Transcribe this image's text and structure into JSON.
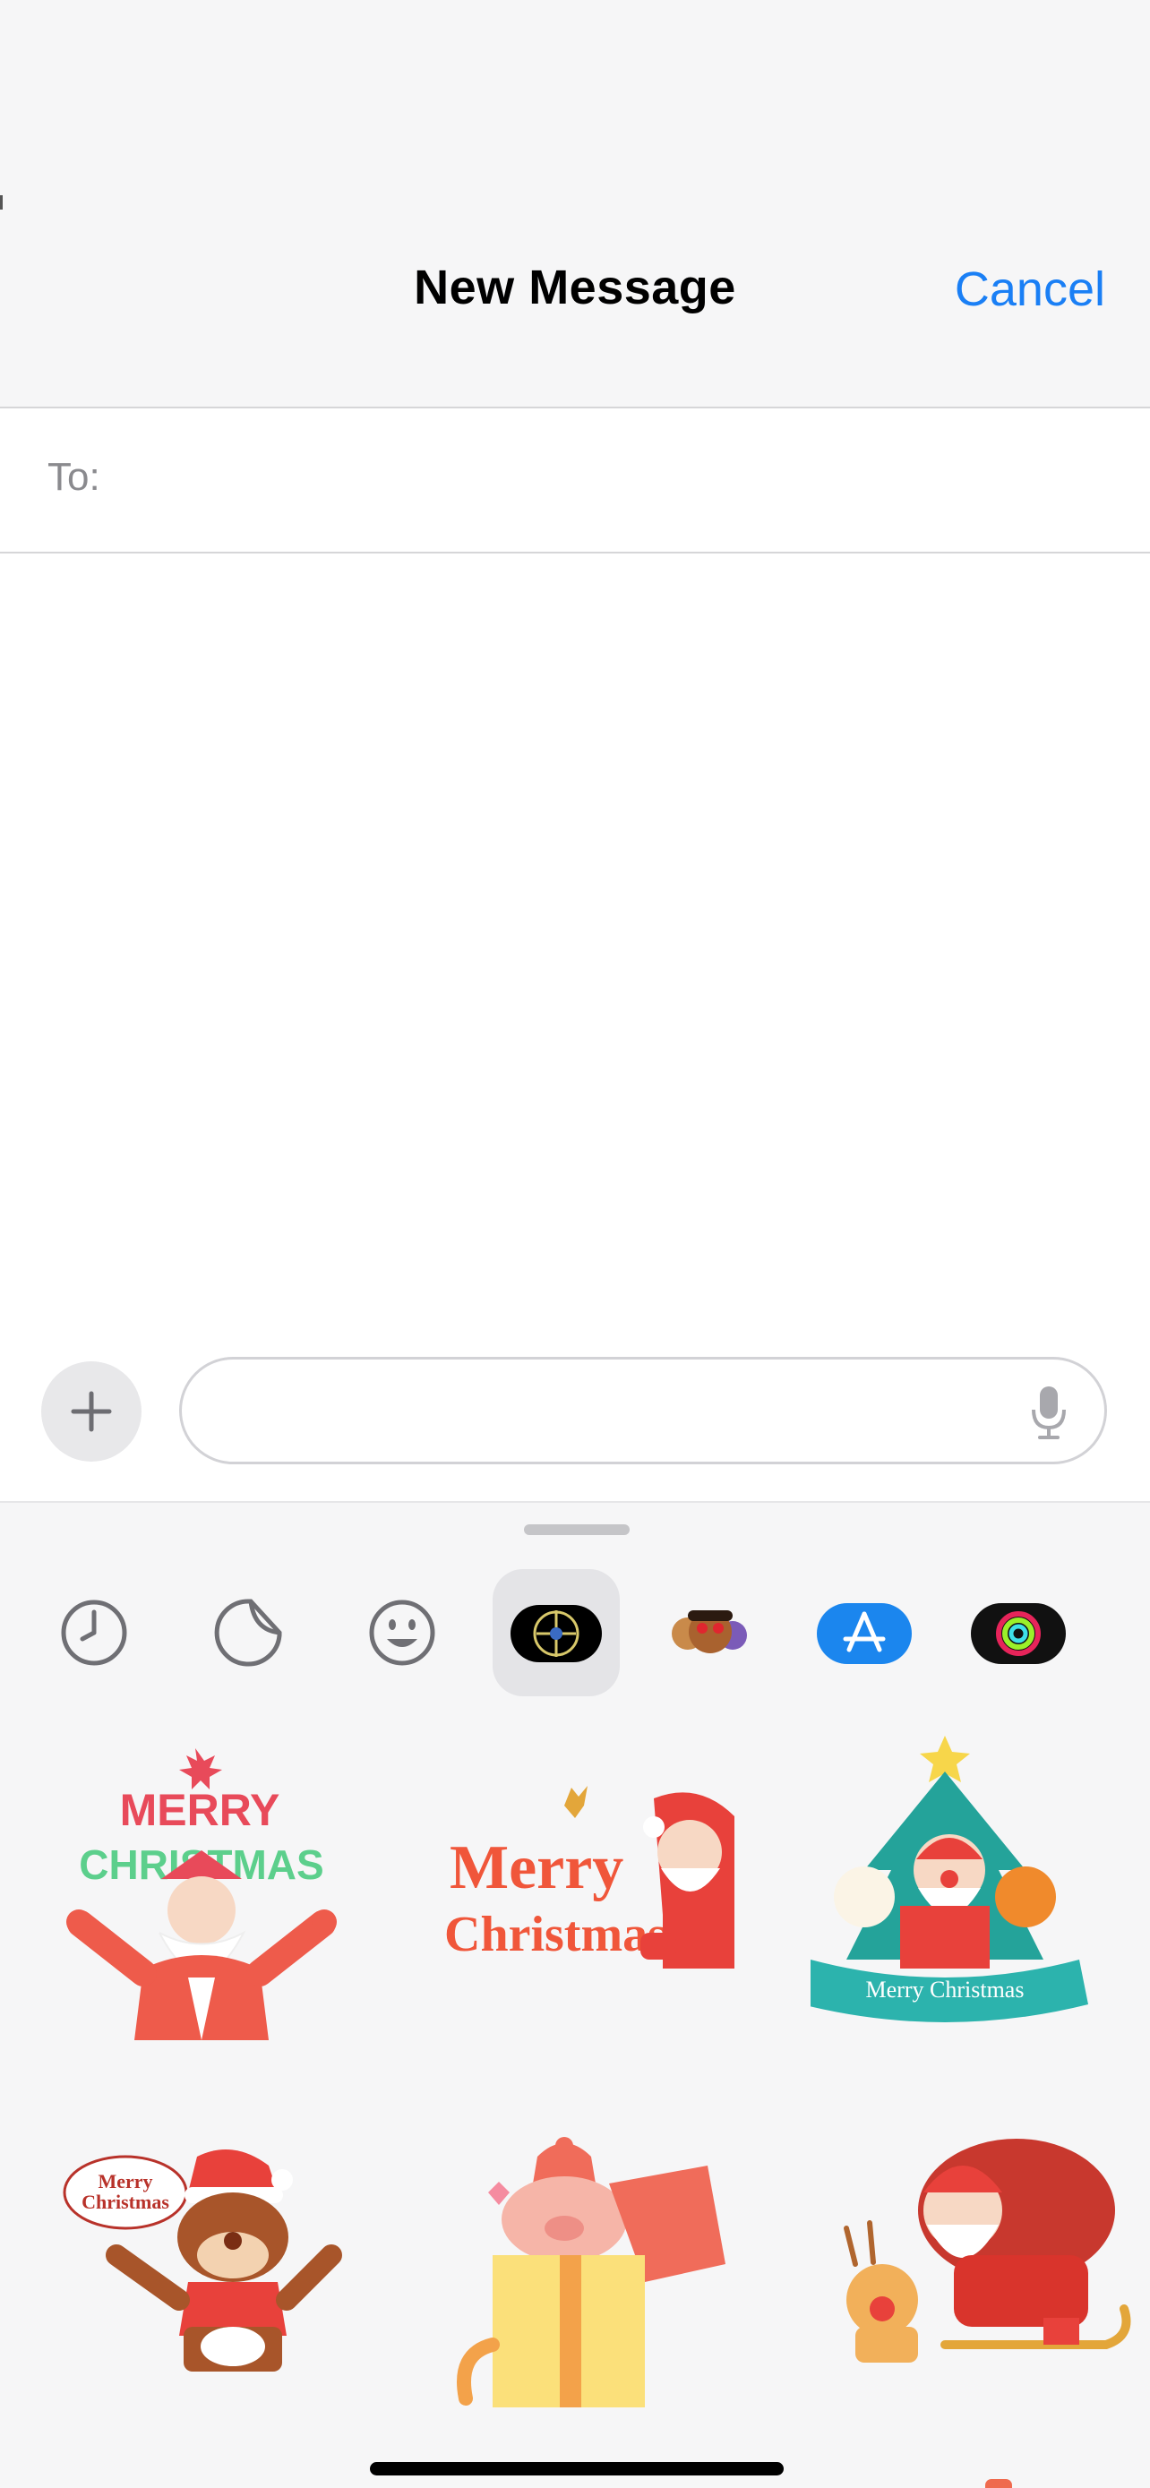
{
  "header": {
    "title": "New Message",
    "cancel_label": "Cancel"
  },
  "to_field": {
    "label": "To:",
    "value": ""
  },
  "compose": {
    "message_value": "",
    "plus_icon": "plus-icon",
    "mic_icon": "microphone-icon"
  },
  "app_drawer": {
    "apps": [
      {
        "name": "recents",
        "icon": "clock-icon"
      },
      {
        "name": "stickers",
        "icon": "sticker-icon"
      },
      {
        "name": "emoji",
        "icon": "smiley-icon"
      },
      {
        "name": "sticker-pack",
        "icon": "sticker-pack-icon",
        "selected": true
      },
      {
        "name": "memoji",
        "icon": "memoji-icon"
      },
      {
        "name": "app-store",
        "icon": "app-store-icon"
      },
      {
        "name": "fitness",
        "icon": "activity-rings-icon"
      }
    ],
    "stickers": [
      {
        "name": "sticker-santa-merry-christmas",
        "text": [
          "MERRY",
          "CHRISTMAS"
        ]
      },
      {
        "name": "sticker-merry-christmas-santa-peek",
        "text": [
          "Merry",
          "Christmas"
        ]
      },
      {
        "name": "sticker-christmas-tree-banner",
        "text": [
          "Merry Christmas"
        ]
      },
      {
        "name": "sticker-reindeer-merry-christmas",
        "text": [
          "Merry",
          "Christmas"
        ]
      },
      {
        "name": "sticker-pig-gift-box",
        "text": []
      },
      {
        "name": "sticker-santa-sleigh-reindeer",
        "text": []
      }
    ]
  },
  "colors": {
    "accent": "#1a7ff5",
    "header_bg": "#f6f6f7",
    "divider": "#d6d6d8"
  }
}
